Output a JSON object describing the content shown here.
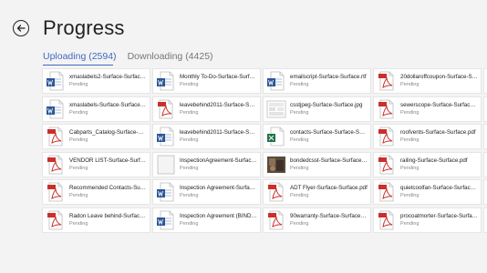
{
  "header": {
    "title": "Progress"
  },
  "tabs": [
    {
      "label": "Uploading (2594)",
      "active": true
    },
    {
      "label": "Downloading (4425)",
      "active": false
    }
  ],
  "colors": {
    "accent": "#3f6ac0",
    "pdf": "#c9302c",
    "word": "#2b5797",
    "excel": "#217346"
  },
  "files": [
    {
      "name": "xmaslabels2-Surface-Surface-Su...",
      "status": "Pending",
      "type": "word"
    },
    {
      "name": "Monthly To-Do-Surface-Surface...",
      "status": "Pending",
      "type": "word"
    },
    {
      "name": "emailscript-Surface-Surface.rtf",
      "status": "Pending",
      "type": "word"
    },
    {
      "name": "20dollaroffcoupon-Surface-Surf...",
      "status": "Pending",
      "type": "pdf"
    },
    {
      "name": "xmaslabels-Surface-Surface-Surf...",
      "status": "Pending",
      "type": "word"
    },
    {
      "name": "leavebehind2011-Surface-Surfac...",
      "status": "Pending",
      "type": "pdf"
    },
    {
      "name": "csstjpeg-Surface-Surface.jpg",
      "status": "Pending",
      "type": "image"
    },
    {
      "name": "sewerscope-Surface-Surface.pdf",
      "status": "Pending",
      "type": "pdf"
    },
    {
      "name": "Cabparts_Catalog-Surface-Surfa...",
      "status": "Pending",
      "type": "pdf"
    },
    {
      "name": "leavebehind2011-Surface-Surfac...",
      "status": "Pending",
      "type": "word"
    },
    {
      "name": "contacts-Surface-Surface-Surfac...",
      "status": "Pending",
      "type": "excel"
    },
    {
      "name": "roofvents-Surface-Surface.pdf",
      "status": "Pending",
      "type": "pdf"
    },
    {
      "name": "VENDOR LIST-Surface-Surface.pdf",
      "status": "Pending",
      "type": "pdf"
    },
    {
      "name": "InspectionAgreement-Surface-S...",
      "status": "Pending",
      "type": "blank"
    },
    {
      "name": "bondedcsst-Surface-Surface.jpg",
      "status": "Pending",
      "type": "photo"
    },
    {
      "name": "railing-Surface-Surface.pdf",
      "status": "Pending",
      "type": "pdf"
    },
    {
      "name": "Recommended Contacts-Surfac...",
      "status": "Pending",
      "type": "pdf"
    },
    {
      "name": "Inspection Agreement-Surface-S...",
      "status": "Pending",
      "type": "word"
    },
    {
      "name": "ADT Flyer-Surface-Surface.pdf",
      "status": "Pending",
      "type": "pdf"
    },
    {
      "name": "quietcoolfan-Surface-Surface.pdf",
      "status": "Pending",
      "type": "pdf"
    },
    {
      "name": "Radon Leave behind-Surface-Su...",
      "status": "Pending",
      "type": "pdf"
    },
    {
      "name": "Inspection Agreement (BINDER)...",
      "status": "Pending",
      "type": "word"
    },
    {
      "name": "90warranty-Surface-Surface.pdf",
      "status": "Pending",
      "type": "pdf"
    },
    {
      "name": "procoatmorter-Surface-Surface....",
      "status": "Pending",
      "type": "pdf"
    }
  ]
}
